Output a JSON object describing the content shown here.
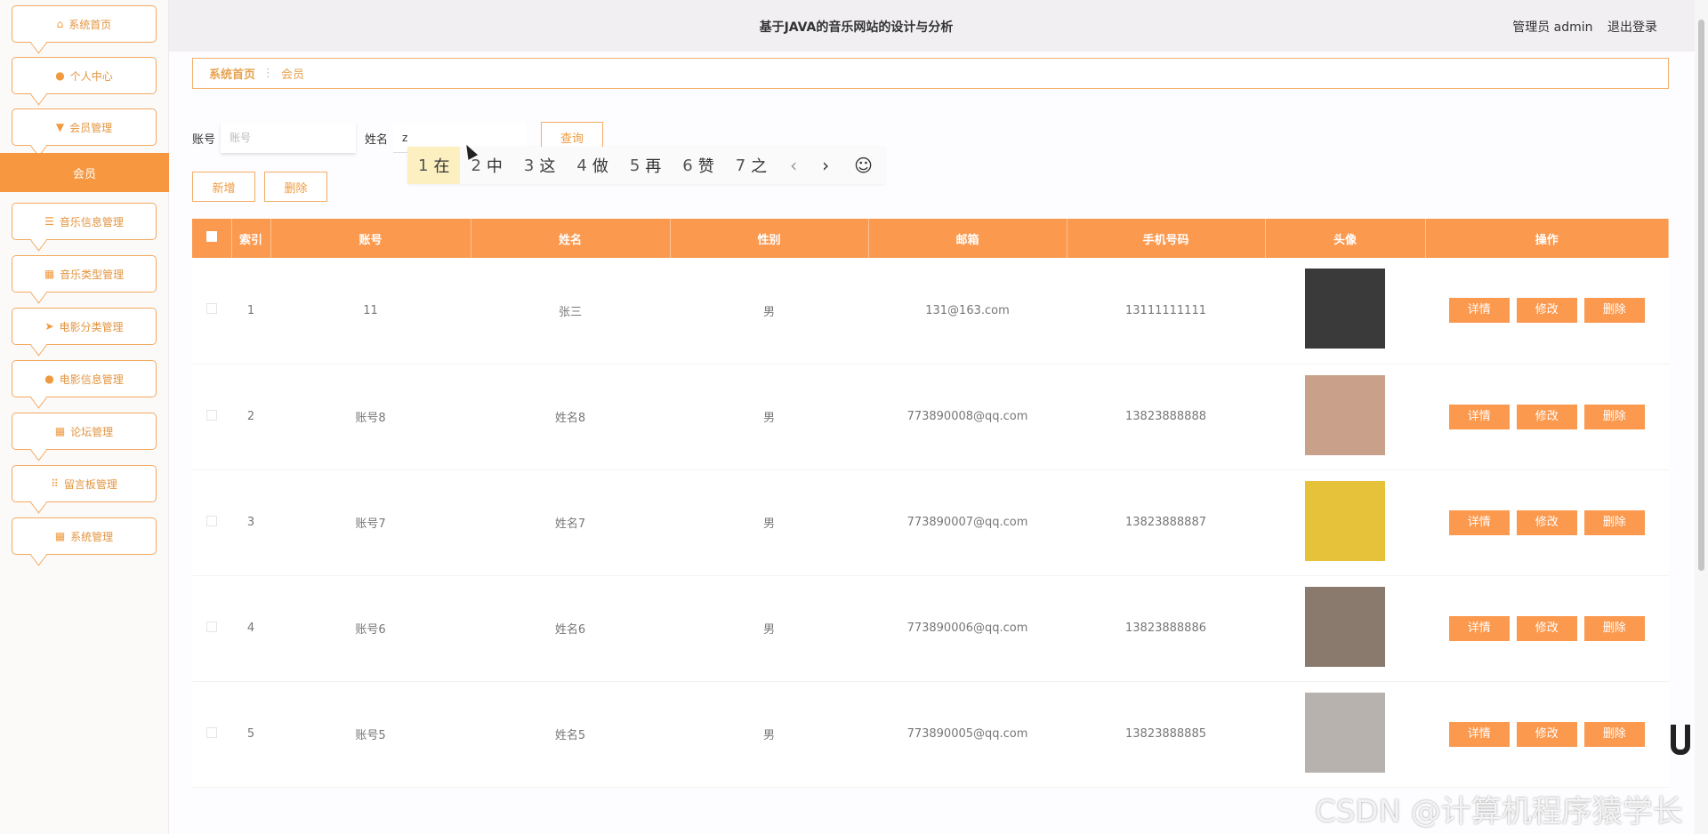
{
  "header": {
    "title": "基于JAVA的音乐网站的设计与分析",
    "user_role": "管理员 admin",
    "logout": "退出登录"
  },
  "sidebar": {
    "items": [
      {
        "label": "系统首页",
        "icon": "home-icon"
      },
      {
        "label": "个人中心",
        "icon": "user-icon"
      },
      {
        "label": "会员管理",
        "icon": "member-icon"
      },
      {
        "label": "音乐信息管理",
        "icon": "list-icon"
      },
      {
        "label": "音乐类型管理",
        "icon": "grid-icon"
      },
      {
        "label": "电影分类管理",
        "icon": "send-icon"
      },
      {
        "label": "电影信息管理",
        "icon": "balloon-icon"
      },
      {
        "label": "论坛管理",
        "icon": "grid-icon"
      },
      {
        "label": "留言板管理",
        "icon": "apps-icon"
      },
      {
        "label": "系统管理",
        "icon": "grid-icon"
      }
    ],
    "active_sub": "会员"
  },
  "breadcrumb": {
    "home": "系统首页",
    "sep": "⋮",
    "current": "会员"
  },
  "search": {
    "account_label": "账号",
    "account_placeholder": "账号",
    "name_label": "姓名",
    "name_value": "z",
    "query_button": "查询"
  },
  "ime": {
    "candidates": [
      {
        "n": "1",
        "c": "在"
      },
      {
        "n": "2",
        "c": "中"
      },
      {
        "n": "3",
        "c": "这"
      },
      {
        "n": "4",
        "c": "做"
      },
      {
        "n": "5",
        "c": "再"
      },
      {
        "n": "6",
        "c": "赞"
      },
      {
        "n": "7",
        "c": "之"
      }
    ]
  },
  "actions": {
    "add": "新增",
    "delete": "删除"
  },
  "table": {
    "headers": [
      "索引",
      "账号",
      "姓名",
      "性别",
      "邮箱",
      "手机号码",
      "头像",
      "操作"
    ],
    "row_actions": {
      "detail": "详情",
      "edit": "修改",
      "delete": "删除"
    },
    "rows": [
      {
        "index": "1",
        "account": "11",
        "name": "张三",
        "gender": "男",
        "email": "131@163.com",
        "phone": "13111111111",
        "avatar_color": "#3a3a3a"
      },
      {
        "index": "2",
        "account": "账号8",
        "name": "姓名8",
        "gender": "男",
        "email": "773890008@qq.com",
        "phone": "13823888888",
        "avatar_color": "#c9a08a"
      },
      {
        "index": "3",
        "account": "账号7",
        "name": "姓名7",
        "gender": "男",
        "email": "773890007@qq.com",
        "phone": "13823888887",
        "avatar_color": "#e6c13a"
      },
      {
        "index": "4",
        "account": "账号6",
        "name": "姓名6",
        "gender": "男",
        "email": "773890006@qq.com",
        "phone": "13823888886",
        "avatar_color": "#8a7a6e"
      },
      {
        "index": "5",
        "account": "账号5",
        "name": "姓名5",
        "gender": "男",
        "email": "773890005@qq.com",
        "phone": "13823888885",
        "avatar_color": "#b8b2ae"
      }
    ]
  },
  "watermark": "CSDN @计算机程序猿学长",
  "colors": {
    "accent": "#fb994f",
    "accent_border": "#f4ad66",
    "ime_highlight": "#fdf0c0"
  }
}
